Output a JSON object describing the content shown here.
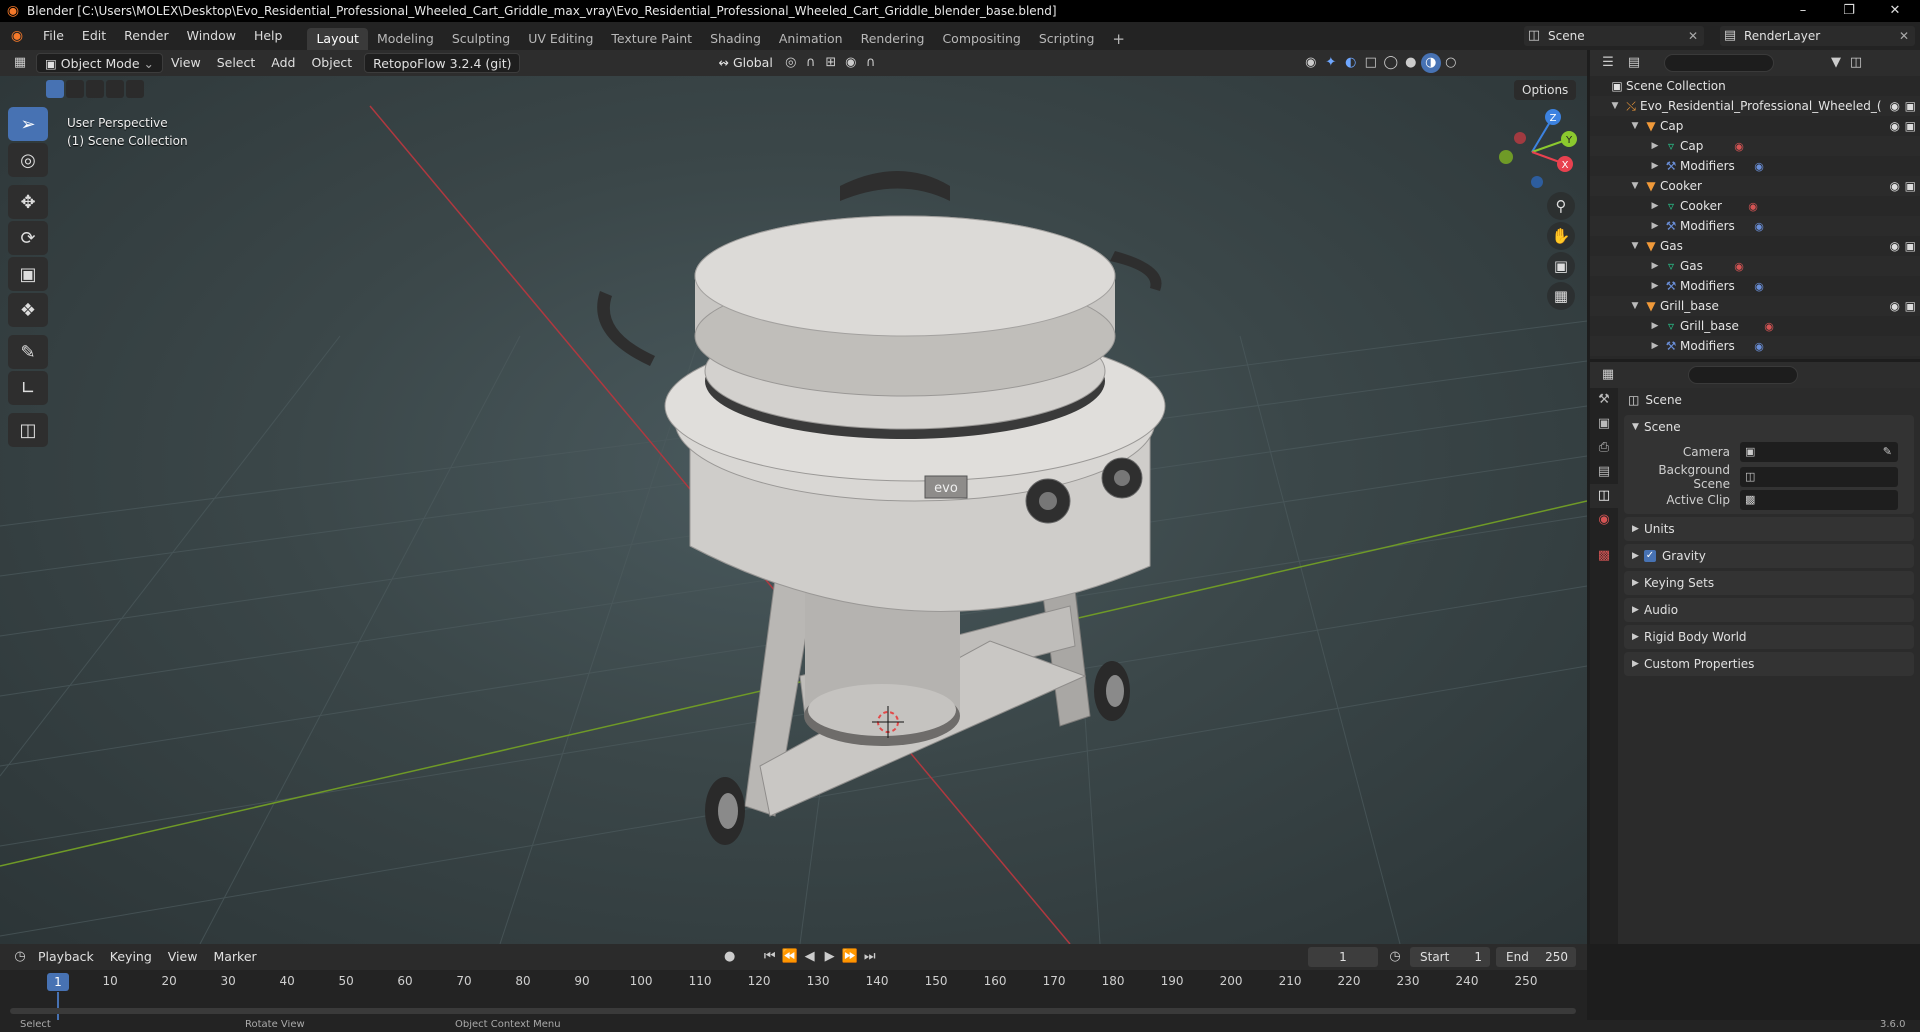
{
  "window": {
    "title": "Blender [C:\\Users\\MOLEX\\Desktop\\Evo_Residential_Professional_Wheeled_Cart_Griddle_max_vray\\Evo_Residential_Professional_Wheeled_Cart_Griddle_blender_base.blend]"
  },
  "menu": {
    "items": [
      "File",
      "Edit",
      "Render",
      "Window",
      "Help"
    ],
    "workspaces": [
      "Layout",
      "Modeling",
      "Sculpting",
      "UV Editing",
      "Texture Paint",
      "Shading",
      "Animation",
      "Rendering",
      "Compositing",
      "Scripting"
    ],
    "active_workspace": "Layout",
    "scene": "Scene",
    "view_layer": "RenderLayer"
  },
  "viewport_header": {
    "mode": "Object Mode",
    "menus": [
      "View",
      "Select",
      "Add",
      "Object"
    ],
    "addon": "RetopoFlow 3.2.4 (git)",
    "orientation": "Global",
    "options": "Options"
  },
  "viewport": {
    "perspective": "User Perspective",
    "collection": "(1) Scene Collection",
    "brand_label": "evo",
    "gizmo_axes": [
      "Z",
      "Y",
      "X"
    ]
  },
  "outliner": {
    "root": "Scene Collection",
    "collection": "Evo_Residential_Professional_Wheeled_(",
    "objects": [
      {
        "name": "Cap",
        "mesh": "Cap",
        "modifiers": "Modifiers"
      },
      {
        "name": "Cooker",
        "mesh": "Cooker",
        "modifiers": "Modifiers"
      },
      {
        "name": "Gas",
        "mesh": "Gas",
        "modifiers": "Modifiers"
      },
      {
        "name": "Grill_base",
        "mesh": "Grill_base",
        "modifiers": "Modifiers"
      }
    ]
  },
  "properties": {
    "context": "Scene",
    "panel_title": "Scene",
    "fields": [
      {
        "label": "Camera",
        "value": ""
      },
      {
        "label": "Background Scene",
        "value": ""
      },
      {
        "label": "Active Clip",
        "value": ""
      }
    ],
    "panels": [
      "Units",
      "Gravity",
      "Keying Sets",
      "Audio",
      "Rigid Body World",
      "Custom Properties"
    ],
    "gravity_checked": true
  },
  "timeline": {
    "menus": [
      "Playback",
      "Keying",
      "View",
      "Marker"
    ],
    "current_frame": "1",
    "start_label": "Start",
    "start": "1",
    "end_label": "End",
    "end": "250",
    "ticks": [
      "1",
      "10",
      "20",
      "30",
      "40",
      "50",
      "60",
      "70",
      "80",
      "90",
      "100",
      "110",
      "120",
      "130",
      "140",
      "150",
      "160",
      "170",
      "180",
      "190",
      "200",
      "210",
      "220",
      "230",
      "240",
      "250"
    ]
  },
  "statusbar": {
    "select": "Select",
    "rotate": "Rotate View",
    "context_menu": "Object Context Menu",
    "version": "3.6.0"
  },
  "colors": {
    "accent": "#4772b3",
    "object": "#f19a3a",
    "mesh": "#29c28b",
    "x_axis": "#e8414f",
    "y_axis": "#8bc92e",
    "z_axis": "#3c82e0"
  }
}
